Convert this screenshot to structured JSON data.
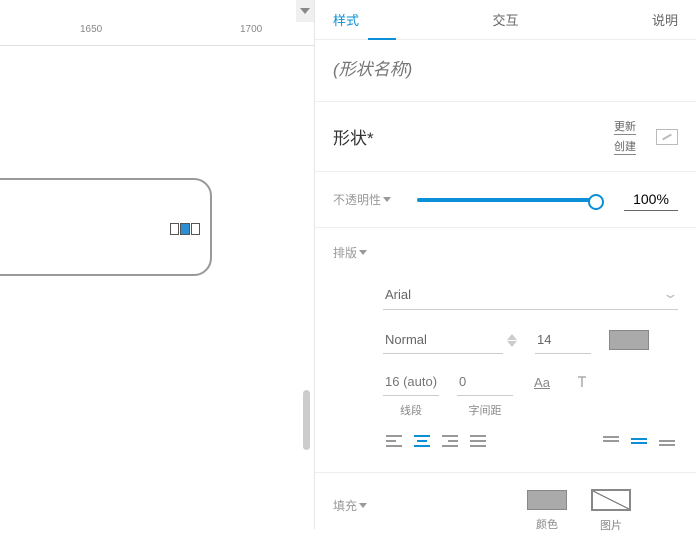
{
  "tabs": {
    "style": "样式",
    "interact": "交互",
    "desc": "说明"
  },
  "shape_name_placeholder": "(形状名称)",
  "shape_title": "形状*",
  "actions": {
    "update": "更新",
    "create": "创建"
  },
  "opacity": {
    "label": "不透明性",
    "value": "100%"
  },
  "typo": {
    "label": "排版",
    "font_family": "Arial",
    "font_style": "Normal",
    "font_size": "14",
    "line_height_placeholder": "16 (auto)",
    "letter_spacing_placeholder": "0",
    "line_label": "线段",
    "spacing_label": "字间距"
  },
  "fill": {
    "label": "填充",
    "color_label": "颜色",
    "image_label": "图片"
  },
  "ruler": {
    "t1": "1650",
    "t2": "1700"
  }
}
